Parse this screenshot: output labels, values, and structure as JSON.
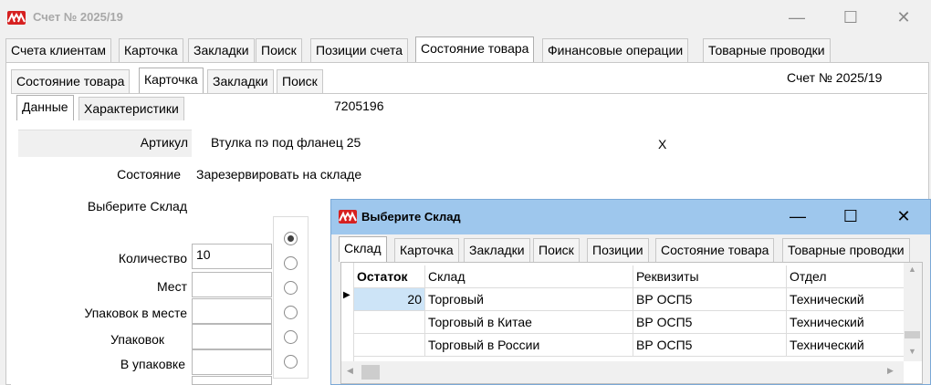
{
  "window": {
    "title": "Счет № 2025/19",
    "minimize_glyph": "—",
    "maximize_glyph": "☐",
    "close_glyph": "✕"
  },
  "main_tabs": [
    {
      "label": "Счета клиентам",
      "active": false
    },
    {
      "label": "Карточка",
      "active": false
    },
    {
      "label": "Закладки",
      "active": false
    },
    {
      "label": "Поиск",
      "active": false
    },
    {
      "label": "Позиции счета",
      "active": false
    },
    {
      "label": "Состояние товара",
      "active": true
    },
    {
      "label": "Финансовые операции",
      "active": false
    },
    {
      "label": "Товарные проводки",
      "active": false
    }
  ],
  "sub_tabs": [
    {
      "label": "Состояние товара",
      "active": false
    },
    {
      "label": "Карточка",
      "active": true
    },
    {
      "label": "Закладки",
      "active": false
    },
    {
      "label": "Поиск",
      "active": false
    }
  ],
  "invoice_label": "Счет № 2025/19",
  "inner_tabs": [
    {
      "label": "Данные",
      "active": true
    },
    {
      "label": "Характеристики",
      "active": false
    }
  ],
  "card": {
    "code": "7205196",
    "article_label": "Артикул",
    "article_value": "Втулка пэ под фланец 25",
    "x_mark": "X",
    "state_label": "Состояние",
    "state_value": "Зарезервировать на складе",
    "warehouse_label": "Выберите Склад",
    "quantity_label": "Количество",
    "quantity_value": "10",
    "places_label": "Мест",
    "places_value": "",
    "packages_in_place_label": "Упаковок в месте",
    "packages_in_place_value": "",
    "packages_label": "Упаковок",
    "packages_value": "",
    "in_package_label": "В упаковке",
    "in_package_value": ""
  },
  "radio_selected_index": 0,
  "dialog": {
    "title": "Выберите Склад",
    "minimize_glyph": "—",
    "maximize_glyph": "☐",
    "close_glyph": "✕",
    "tabs": [
      {
        "label": "Склад",
        "active": true
      },
      {
        "label": "Карточка",
        "active": false
      },
      {
        "label": "Закладки",
        "active": false
      },
      {
        "label": "Поиск",
        "active": false
      },
      {
        "label": "Позиции",
        "active": false
      },
      {
        "label": "Состояние товара",
        "active": false
      },
      {
        "label": "Товарные проводки",
        "active": false
      }
    ],
    "columns": [
      "Остаток",
      "Склад",
      "Реквизиты",
      "Отдел"
    ],
    "rows": [
      {
        "balance": "20",
        "warehouse": "Торговый",
        "details": "ВР ОСП5",
        "department": "Технический"
      },
      {
        "balance": "",
        "warehouse": "Торговый в Китае",
        "details": "ВР ОСП5",
        "department": "Технический"
      },
      {
        "balance": "",
        "warehouse": "Торговый в России",
        "details": "ВР ОСП5",
        "department": "Технический"
      }
    ],
    "current_row_marker": "▶"
  },
  "colors": {
    "dialog_title_bg": "#9ec7ed",
    "selected_cell_bg": "#cde4f7",
    "logo_red": "#d62020"
  }
}
